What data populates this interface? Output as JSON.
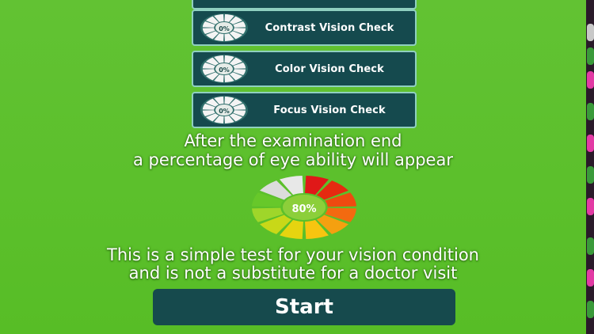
{
  "buttons": [
    {
      "name": "partial-check-button",
      "label": ""
    },
    {
      "name": "contrast-vision-check-button",
      "label": "Contrast Vision Check"
    },
    {
      "name": "color-vision-check-button",
      "label": "Color Vision Check"
    },
    {
      "name": "focus-vision-check-button",
      "label": "Focus Vision Check"
    }
  ],
  "dial_label": "0%",
  "info": {
    "line1": "After the examination end",
    "line2": "a percentage of eye ability  will appear"
  },
  "gauge": {
    "label": "80%",
    "value": 0.8
  },
  "disclaimer": {
    "line1": "This is a simple test for your vision condition",
    "line2": "and is not a substitute for a doctor visit"
  },
  "start_label": "Start",
  "colors": {
    "background": "#5cc02c",
    "button": "#154a4e"
  }
}
